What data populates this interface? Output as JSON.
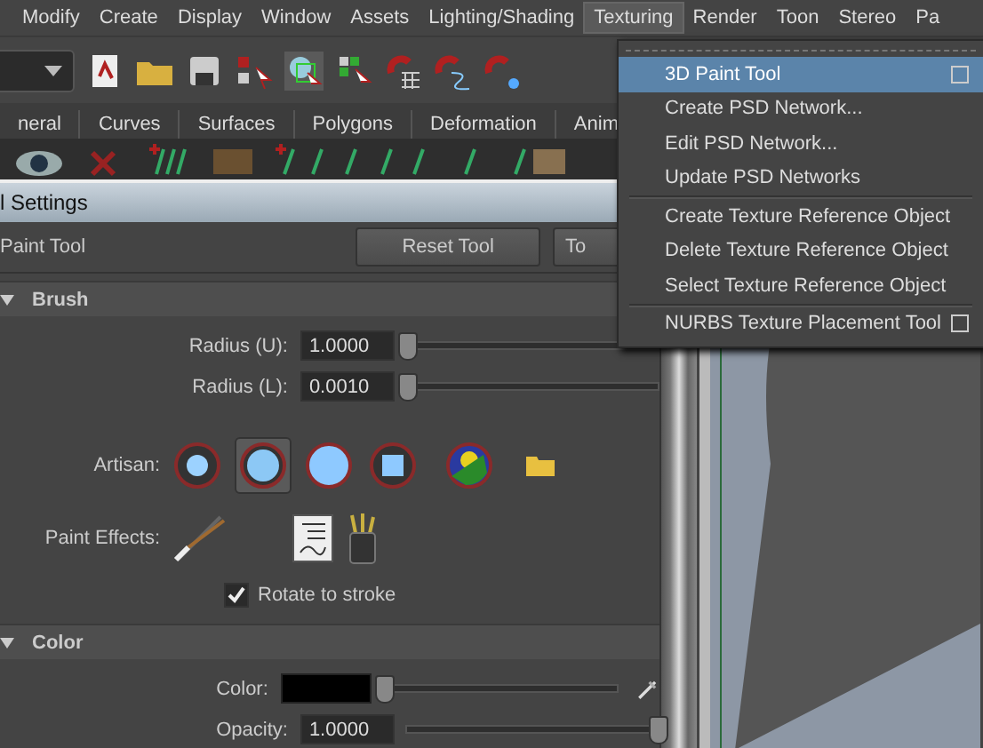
{
  "menu_bar": [
    {
      "label": "Modify",
      "selected": false
    },
    {
      "label": "Create",
      "selected": false
    },
    {
      "label": "Display",
      "selected": false
    },
    {
      "label": "Window",
      "selected": false
    },
    {
      "label": "Assets",
      "selected": false
    },
    {
      "label": "Lighting/Shading",
      "selected": false
    },
    {
      "label": "Texturing",
      "selected": true
    },
    {
      "label": "Render",
      "selected": false
    },
    {
      "label": "Toon",
      "selected": false
    },
    {
      "label": "Stereo",
      "selected": false
    },
    {
      "label": "Pa",
      "selected": false
    }
  ],
  "shelf_tabs": [
    {
      "label": "neral",
      "selected": false
    },
    {
      "label": "Curves",
      "selected": false
    },
    {
      "label": "Surfaces",
      "selected": false
    },
    {
      "label": "Polygons",
      "selected": false
    },
    {
      "label": "Deformation",
      "selected": false
    },
    {
      "label": "Anim",
      "selected": false
    }
  ],
  "tool_settings": {
    "title": "l Settings",
    "tool_name": "Paint Tool",
    "buttons": [
      "Reset Tool",
      "To"
    ],
    "sections": [
      {
        "title": "Brush",
        "expanded": true,
        "kind": "brush",
        "fields": [
          {
            "label": "Radius (U):",
            "value": "1.0000",
            "level": 0.0
          },
          {
            "label": "Radius (L):",
            "value": "0.0010",
            "level": 0.0
          }
        ],
        "artisan_label": "Artisan:",
        "artisan_brushes": [
          {
            "selected": false
          },
          {
            "selected": true
          },
          {
            "selected": false
          },
          {
            "selected": false
          }
        ],
        "paint_effects_label": "Paint Effects:",
        "rotate_to_stroke": {
          "label": "Rotate to stroke",
          "checked": true
        }
      },
      {
        "title": "Color",
        "expanded": true,
        "kind": "color",
        "fields": [
          {
            "label": "Color:",
            "color": "#000000",
            "level": 0.0
          },
          {
            "label": "Opacity:",
            "value": "1.0000",
            "level": 1.0
          }
        ]
      }
    ]
  },
  "texturing_menu": [
    {
      "kind": "item",
      "label": "3D Paint Tool",
      "selected": true,
      "option_box": true
    },
    {
      "kind": "item",
      "label": "Create PSD Network...",
      "selected": false,
      "option_box": false
    },
    {
      "kind": "item",
      "label": "Edit PSD Network...",
      "selected": false,
      "option_box": false
    },
    {
      "kind": "item",
      "label": "Update PSD Networks",
      "selected": false,
      "option_box": false
    },
    {
      "kind": "separator"
    },
    {
      "kind": "item",
      "label": "Create Texture Reference Object",
      "selected": false,
      "option_box": false
    },
    {
      "kind": "item",
      "label": "Delete Texture Reference Object",
      "selected": false,
      "option_box": false
    },
    {
      "kind": "item",
      "label": "Select Texture Reference Object",
      "selected": false,
      "option_box": false
    },
    {
      "kind": "separator"
    },
    {
      "kind": "item",
      "label": "NURBS Texture Placement Tool",
      "selected": false,
      "option_box": true
    }
  ]
}
